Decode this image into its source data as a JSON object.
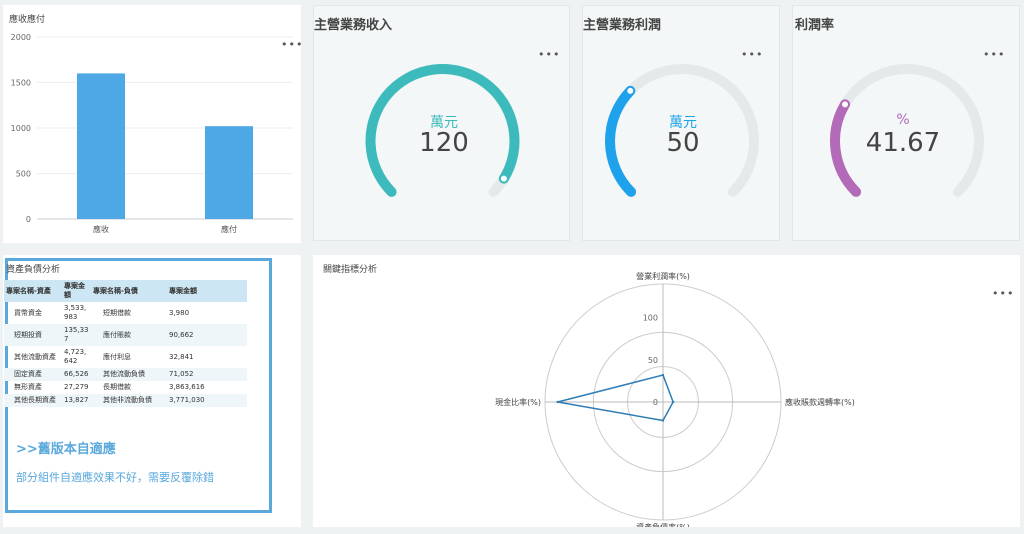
{
  "receivable_chart": {
    "title": "應收應付",
    "chart_data": {
      "type": "bar",
      "categories": [
        "應收",
        "應付"
      ],
      "values": [
        1600,
        1020
      ],
      "ylim": [
        0,
        2000
      ],
      "yticks": [
        "0",
        "500",
        "1000",
        "1500",
        "2000"
      ],
      "color": "#4fa8e6"
    }
  },
  "gauges": [
    {
      "title": "主營業務收入",
      "unit": "萬元",
      "value": "120",
      "fraction": 0.95,
      "color": "#3dbbbc",
      "unit_color": "#3dbbbc"
    },
    {
      "title": "主營業務利潤",
      "unit": "萬元",
      "value": "50",
      "fraction": 0.33,
      "color": "#1ea2ec",
      "unit_color": "#1ea2ec"
    },
    {
      "title": "利潤率",
      "unit": "%",
      "value": "41.67",
      "fraction": 0.28,
      "color": "#b36ab8",
      "unit_color": "#b36ab8"
    }
  ],
  "balance_sheet": {
    "title": "資產負債分析",
    "headers": [
      "專案名稱-資產",
      "專案金額",
      "專案名稱-負債",
      "專案金額"
    ],
    "rows": [
      [
        "貨幣資金",
        "3,533,983",
        "短期借款",
        "3,980"
      ],
      [
        "短期投資",
        "135,337",
        "應付賬款",
        "90,662"
      ],
      [
        "其他流動資產",
        "4,723,642",
        "應付利息",
        "32,841"
      ],
      [
        "固定資產",
        "66,526",
        "其他流動負債",
        "71,052"
      ],
      [
        "無形資產",
        "27,279",
        "長期借款",
        "3,863,616"
      ],
      [
        "其他長期資產",
        "13,827",
        "其他非流動負債",
        "3,771,030"
      ]
    ],
    "note_title": ">>舊版本自適應",
    "note_text": "部分組件自適應效果不好，需要反覆除錯"
  },
  "radar": {
    "title": "關鍵指標分析",
    "chart_data": {
      "type": "radar",
      "indicators": [
        "營業利潤率(%)",
        "應收賬款週轉率(%)",
        "資產負債率(%)",
        "現金比率(%)"
      ],
      "max": 140,
      "ticks": [
        "0",
        "50",
        "100"
      ],
      "values": [
        32,
        12,
        22,
        125
      ],
      "color": "#2e7db5"
    }
  },
  "more_label": "•••"
}
